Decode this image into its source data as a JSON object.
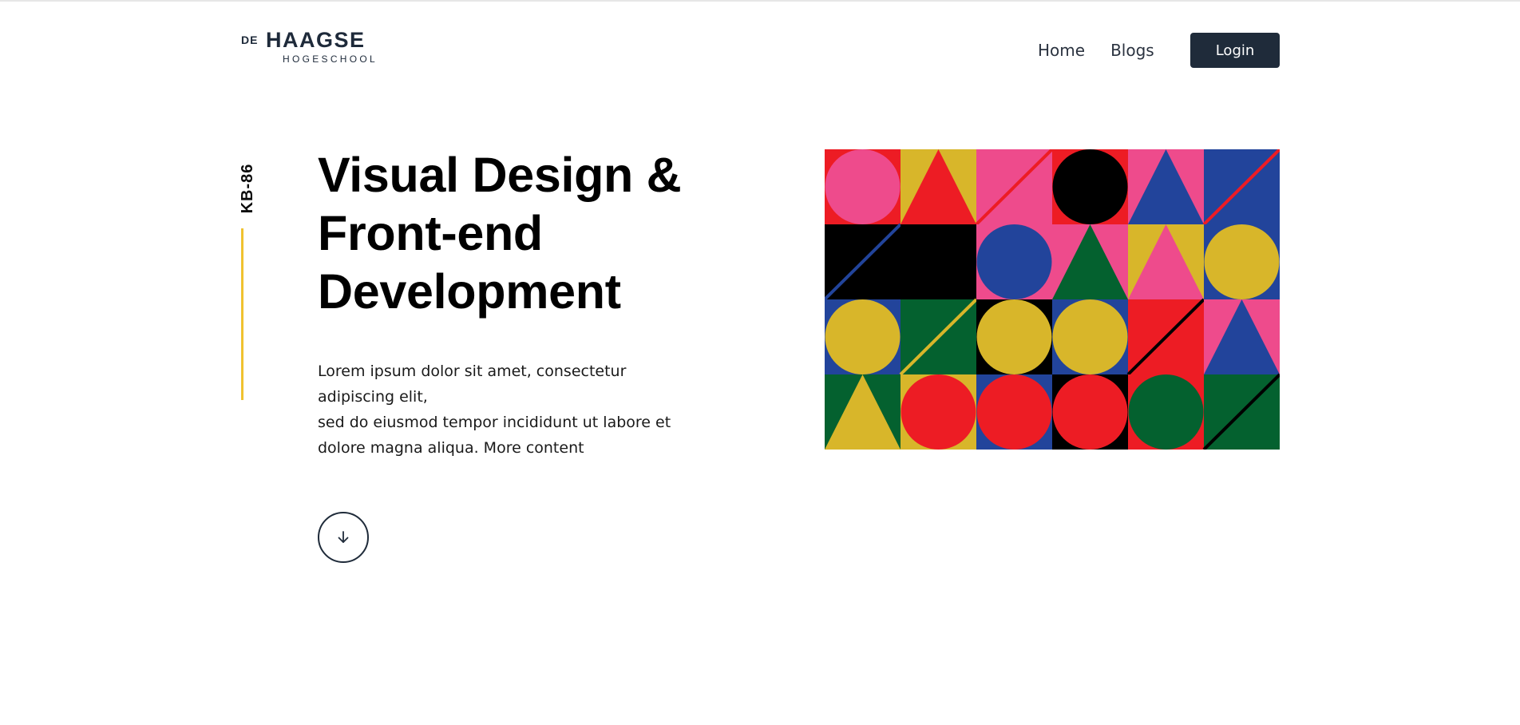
{
  "header": {
    "logo": {
      "de": "DE",
      "name": "HAAGSE",
      "sub": "HOGESCHOOL"
    },
    "nav": [
      {
        "label": "Home"
      },
      {
        "label": "Blogs"
      }
    ],
    "login_label": "Login"
  },
  "hero": {
    "course_code": "KB-86",
    "title_lines": [
      "Visual Design &",
      "Front-end",
      "Development"
    ],
    "description_lines": [
      "Lorem ipsum dolor sit amet, consectetur",
      "adipiscing elit,",
      "sed do eiusmod tempor incididunt ut labore et",
      "dolore magna aliqua. More content"
    ],
    "scroll_icon": "arrow-down-icon"
  },
  "colors": {
    "navy": "#1f2b3a",
    "accent_yellow": "#f0c230",
    "pink": "#ee4b8c",
    "red": "#ed1c24",
    "mustard": "#d8b62a",
    "blue": "#22449b",
    "black": "#000000",
    "green": "#04612f"
  },
  "artwork": {
    "icon": "geometric-pattern-image",
    "grid": [
      [
        {
          "bg": "red",
          "shape": "circle",
          "fg": "pink"
        },
        {
          "bg": "mustard",
          "shape": "triangle",
          "fg": "red"
        },
        {
          "bg": "pink",
          "shape": "diagonal",
          "fg": "red"
        },
        {
          "bg": "red",
          "shape": "circle",
          "fg": "black"
        },
        {
          "bg": "pink",
          "shape": "triangle",
          "fg": "blue"
        },
        {
          "bg": "blue",
          "shape": "diagonal",
          "fg": "red"
        }
      ],
      [
        {
          "bg": "black",
          "shape": "diagonal",
          "fg": "blue"
        },
        {
          "bg": "black",
          "shape": "none",
          "fg": "black"
        },
        {
          "bg": "pink",
          "shape": "circle",
          "fg": "blue"
        },
        {
          "bg": "pink",
          "shape": "triangle",
          "fg": "green"
        },
        {
          "bg": "mustard",
          "shape": "triangle",
          "fg": "pink"
        },
        {
          "bg": "blue",
          "shape": "circle",
          "fg": "mustard"
        }
      ],
      [
        {
          "bg": "blue",
          "shape": "circle",
          "fg": "mustard"
        },
        {
          "bg": "green",
          "shape": "diagonal",
          "fg": "mustard"
        },
        {
          "bg": "black",
          "shape": "circle",
          "fg": "mustard"
        },
        {
          "bg": "blue",
          "shape": "circle",
          "fg": "mustard"
        },
        {
          "bg": "red",
          "shape": "diagonal",
          "fg": "black"
        },
        {
          "bg": "pink",
          "shape": "triangle",
          "fg": "blue"
        }
      ],
      [
        {
          "bg": "green",
          "shape": "triangle",
          "fg": "mustard"
        },
        {
          "bg": "mustard",
          "shape": "circle",
          "fg": "red"
        },
        {
          "bg": "blue",
          "shape": "circle",
          "fg": "red"
        },
        {
          "bg": "black",
          "shape": "circle",
          "fg": "red"
        },
        {
          "bg": "red",
          "shape": "circle",
          "fg": "green"
        },
        {
          "bg": "green",
          "shape": "diagonal",
          "fg": "black"
        }
      ]
    ]
  }
}
